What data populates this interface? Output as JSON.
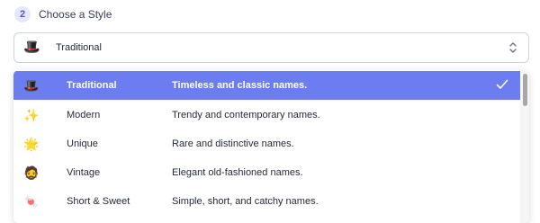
{
  "step": {
    "number": "2",
    "title": "Choose a Style"
  },
  "select": {
    "emoji": "🎩",
    "value": "Traditional"
  },
  "options": [
    {
      "emoji": "🎩",
      "name": "Traditional",
      "description": "Timeless and classic names.",
      "selected": true
    },
    {
      "emoji": "✨",
      "name": "Modern",
      "description": "Trendy and contemporary names.",
      "selected": false
    },
    {
      "emoji": "🌟",
      "name": "Unique",
      "description": "Rare and distinctive names.",
      "selected": false
    },
    {
      "emoji": "🧔",
      "name": "Vintage",
      "description": "Elegant old-fashioned names.",
      "selected": false
    },
    {
      "emoji": "🍬",
      "name": "Short & Sweet",
      "description": "Simple, short, and catchy names.",
      "selected": false
    }
  ],
  "colors": {
    "accent": "#6b7df0",
    "badge_bg": "#e6e8fb",
    "badge_text": "#4f57c9"
  }
}
